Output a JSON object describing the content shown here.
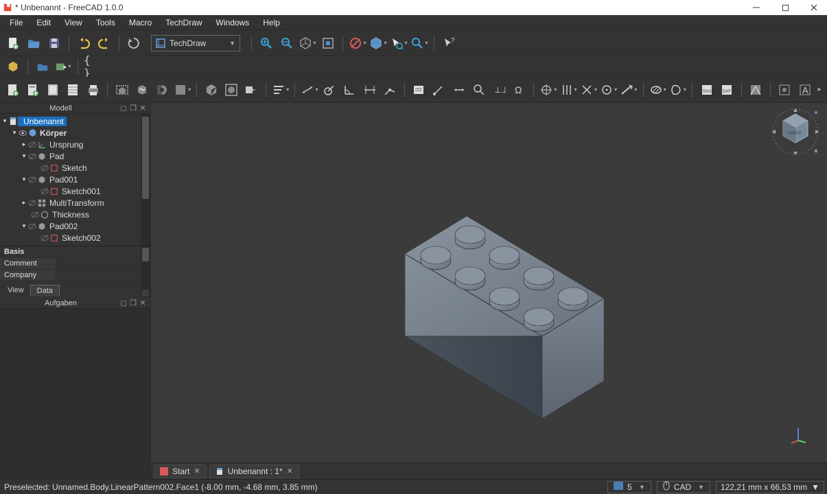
{
  "title": "* Unbenannt - FreeCAD 1.0.0",
  "menus": [
    "File",
    "Edit",
    "View",
    "Tools",
    "Macro",
    "TechDraw",
    "Windows",
    "Help"
  ],
  "workbench": "TechDraw",
  "tree_panel_title": "Modell",
  "tasks_panel_title": "Aufgaben",
  "tree": {
    "doc": "Unbenannt",
    "body": "Körper",
    "items": [
      "Ursprung",
      "Pad",
      "Sketch",
      "Pad001",
      "Sketch001",
      "MultiTransform",
      "Thickness",
      "Pad002",
      "Sketch002"
    ]
  },
  "props": {
    "header": "Basis",
    "rows": [
      {
        "k": "Comment",
        "v": ""
      },
      {
        "k": "Company",
        "v": ""
      }
    ],
    "tabs": [
      "View",
      "Data"
    ],
    "active_tab": "Data"
  },
  "doc_tabs": [
    "Start",
    "Unbenannt : 1*"
  ],
  "status": {
    "text": "Preselected: Unnamed.Body.LinearPattern002.Face1 (-8.00 mm, -4.68 mm, 3.85 mm)",
    "render": "5",
    "cad": "CAD",
    "dim": "122,21 mm x 66,53 mm"
  },
  "navicube_face": "LINKS"
}
